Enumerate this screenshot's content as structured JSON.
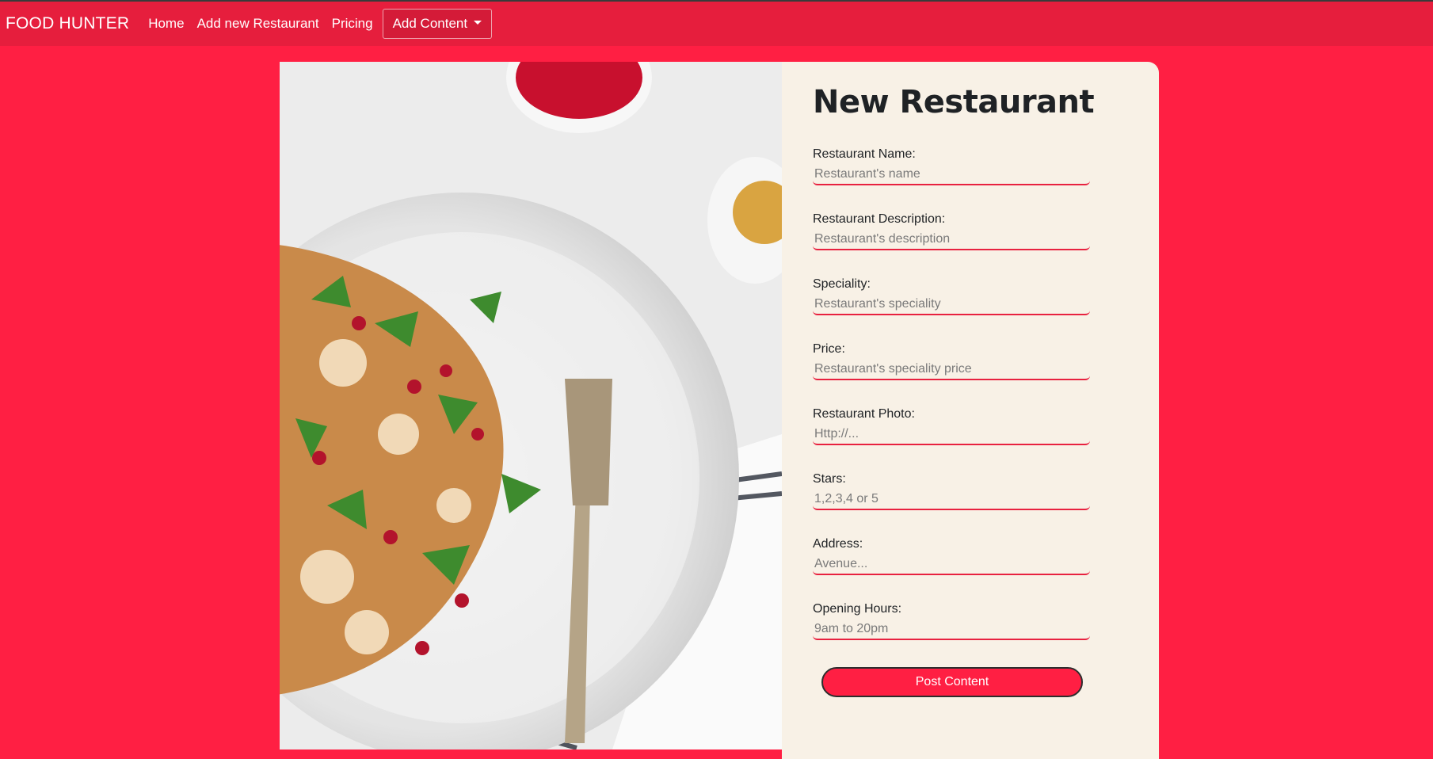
{
  "navbar": {
    "brand": "FOOD HUNTER",
    "links": [
      "Home",
      "Add new Restaurant",
      "Pricing"
    ],
    "dropdown_label": "Add Content"
  },
  "form": {
    "title": "New Restaurant",
    "fields": [
      {
        "label": "Restaurant Name:",
        "placeholder": "Restaurant's name"
      },
      {
        "label": "Restaurant Description:",
        "placeholder": "Restaurant's description"
      },
      {
        "label": "Speciality:",
        "placeholder": "Restaurant's speciality"
      },
      {
        "label": "Price:",
        "placeholder": "Restaurant's speciality price"
      },
      {
        "label": "Restaurant Photo:",
        "placeholder": "Http://..."
      },
      {
        "label": "Stars:",
        "placeholder": "1,2,3,4 or 5"
      },
      {
        "label": "Address:",
        "placeholder": "Avenue..."
      },
      {
        "label": "Opening Hours:",
        "placeholder": "9am to 20pm"
      }
    ],
    "submit_label": "Post Content"
  },
  "colors": {
    "background": "#ff1f43",
    "navbar": "#e61e3d",
    "card": "#f8f1e6",
    "accent": "#e8213f"
  },
  "icons": {
    "dropdown": "caret-down-icon"
  }
}
